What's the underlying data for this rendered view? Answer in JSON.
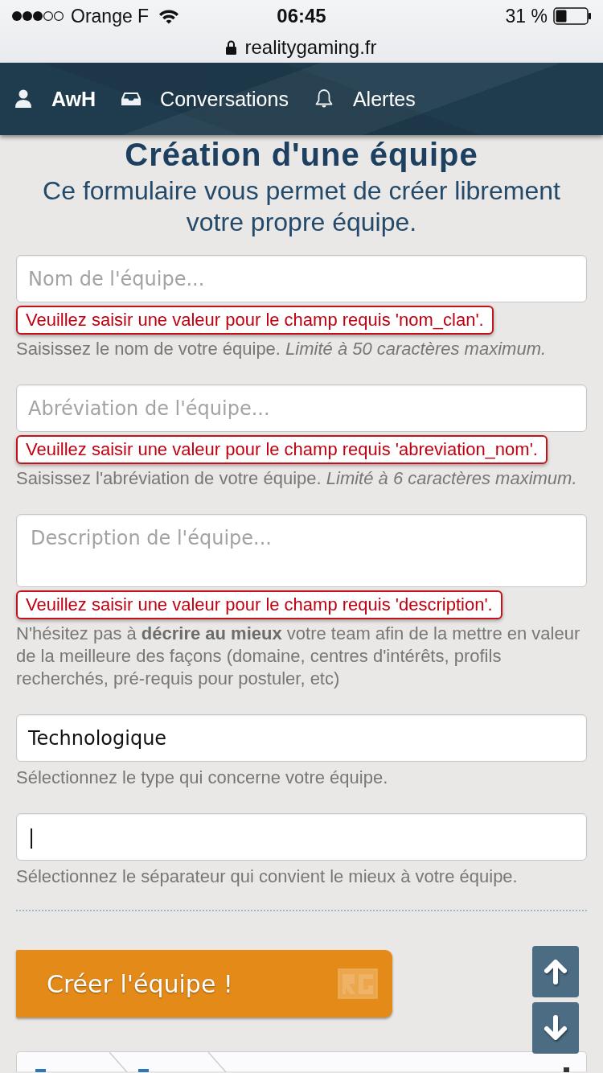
{
  "status_bar": {
    "carrier": "Orange F",
    "time": "06:45",
    "battery": "31 %"
  },
  "address_bar": {
    "url": "realitygaming.fr"
  },
  "nav": {
    "items": [
      {
        "kind": "user",
        "label": "AwH"
      },
      {
        "kind": "inbox",
        "label": "Conversations"
      },
      {
        "kind": "bell",
        "label": "Alertes"
      }
    ]
  },
  "header": {
    "title": "Création d'une équipe",
    "subtitle": "Ce formulaire vous permet de créer librement votre propre équipe."
  },
  "fields": [
    {
      "kind": "text",
      "placeholder": "Nom de l'équipe...",
      "error": "Veuillez saisir une valeur pour le champ requis 'nom_clan'.",
      "hint": "Saisissez le nom de votre équipe. *Limité à 50 caractères maximum.*"
    },
    {
      "kind": "text",
      "placeholder": "Abréviation de l'équipe...",
      "error": "Veuillez saisir une valeur pour le champ requis 'abreviation_nom'.",
      "hint": "Saisissez l'abréviation de votre équipe. *Limité à 6 caractères maximum.*"
    },
    {
      "kind": "textarea",
      "placeholder": "Description de l'équipe...",
      "error": "Veuillez saisir une valeur pour le champ requis 'description'.",
      "hint": "N'hésitez pas à **décrire au mieux** votre team afin de la mettre en valeur de la meilleure des façons (domaine, centres d'intérêts, profils recherchés, pré-requis pour postuler, etc)"
    },
    {
      "kind": "select",
      "value": "Technologique",
      "hint": "Sélectionnez le type qui concerne votre équipe."
    },
    {
      "kind": "select",
      "value": "|",
      "hint": "Sélectionnez le séparateur qui convient le mieux à votre équipe."
    }
  ],
  "submit_button": {
    "label": "Créer l'équipe !"
  }
}
